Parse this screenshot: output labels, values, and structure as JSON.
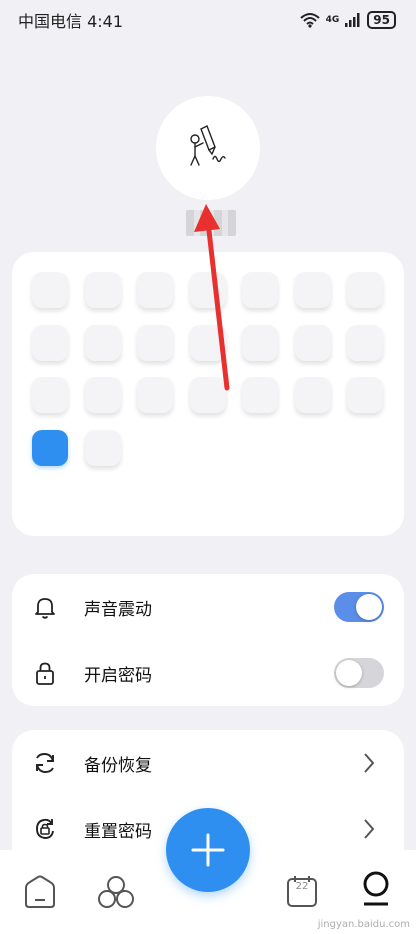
{
  "status_bar": {
    "carrier_time": "中国电信 4:41",
    "network": "4G",
    "battery": "95",
    "wifi_icon": "wifi-icon",
    "signal_icon": "signal-icon"
  },
  "profile": {
    "avatar_icon": "person-with-pencil-icon"
  },
  "color_grid": {
    "rows": 5,
    "columns": 7,
    "tile_count": 23,
    "selected_index": 21,
    "accent": "#2f8ff0"
  },
  "settings": {
    "sound": {
      "label": "声音震动",
      "icon": "bell-icon",
      "enabled": true
    },
    "password": {
      "label": "开启密码",
      "icon": "lock-icon",
      "enabled": false
    }
  },
  "actions": {
    "backup": {
      "label": "备份恢复",
      "icon": "sync-icon"
    },
    "reset": {
      "label": "重置密码",
      "icon": "reset-lock-icon"
    }
  },
  "nav": {
    "home_icon": "home-icon",
    "community_icon": "circles-icon",
    "add_icon": "plus-icon",
    "calendar_icon": "calendar-icon",
    "calendar_date": "22",
    "profile_icon": "profile-icon"
  },
  "watermark": "jingyan.baidu.com",
  "annotation_color": "#e8312f"
}
